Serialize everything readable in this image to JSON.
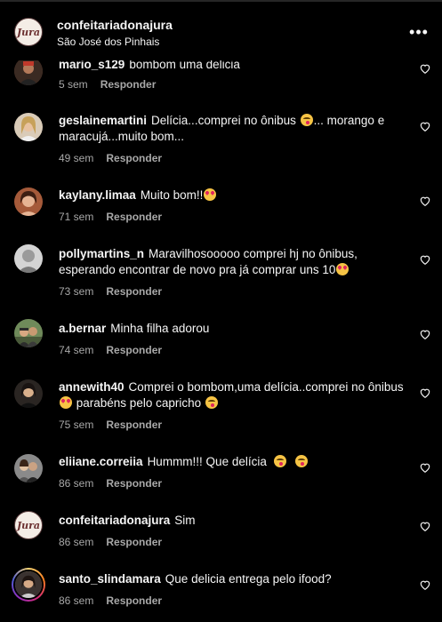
{
  "header": {
    "username": "confeitariadonajura",
    "location": "São José dos Pinhais",
    "more": "•••",
    "logo_text": "Jura"
  },
  "reply_label": "Responder",
  "colors": {
    "background": "#000000",
    "text": "#f5f5f5",
    "muted": "#a8a8a8"
  },
  "comments": [
    {
      "user": "mario_s129",
      "text": "bombom uma delicia",
      "time": "5 sem",
      "avatar": "person"
    },
    {
      "user": "geslainemartini",
      "text": "Delícia...comprei no ônibus",
      "text2": "... morango e maracujá...muito bom...",
      "emoji": "yum",
      "time": "49 sem",
      "avatar": "person"
    },
    {
      "user": "kaylany.limaa",
      "text": "Muito bom!!",
      "emoji": "love",
      "time": "71 sem",
      "avatar": "person"
    },
    {
      "user": "pollymartins_n",
      "text": "Maravilhosooooo comprei hj no ônibus, esperando encontrar de novo pra já comprar uns 10",
      "emoji": "love",
      "time": "73 sem",
      "avatar": "grey"
    },
    {
      "user": "a.bernar",
      "text": "Minha filha adorou",
      "time": "74 sem",
      "avatar": "person"
    },
    {
      "user": "annewith40",
      "text": "Comprei o bombom,uma delícia..comprei no ônibus",
      "text2": "parabéns pelo capricho",
      "emoji": "love",
      "emoji2": "yum",
      "time": "75 sem",
      "avatar": "person"
    },
    {
      "user": "eliiane.correiia",
      "text": "Hummm!!! Que delícia",
      "emoji": "yum",
      "emoji2": "yum",
      "time": "86 sem",
      "avatar": "person"
    },
    {
      "user": "confeitariadonajura",
      "text": "Sim",
      "time": "86 sem",
      "avatar": "logo"
    },
    {
      "user": "santo_slindamara",
      "text": "Que delicia entrega pelo ifood?",
      "time": "86 sem",
      "avatar": "ring"
    }
  ]
}
